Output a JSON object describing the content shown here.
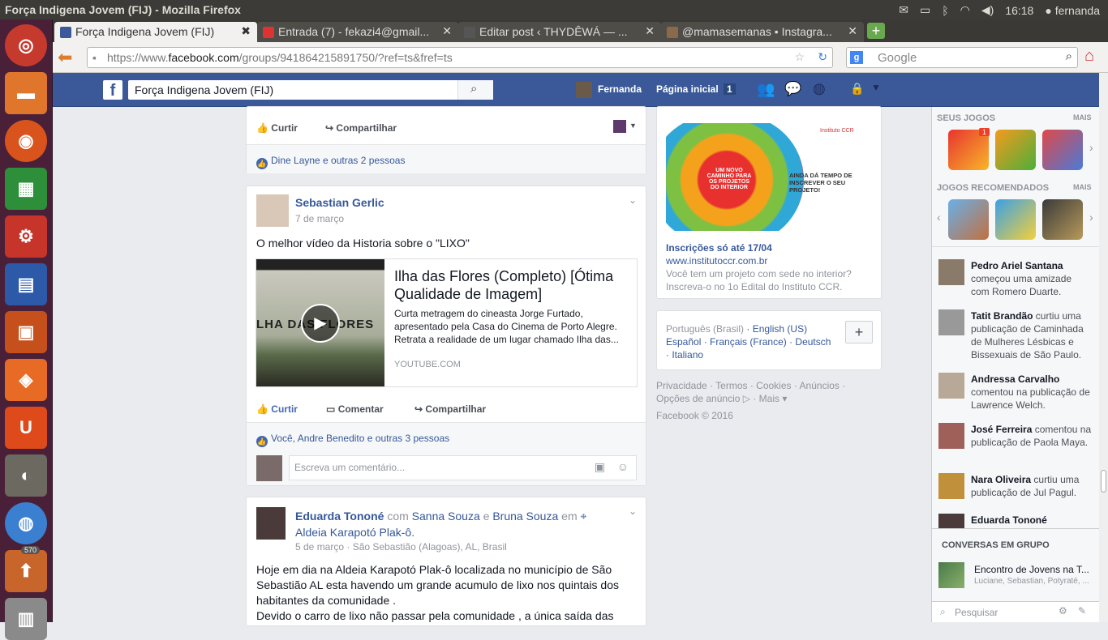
{
  "os": {
    "window_title": "Força Indigena Jovem (FIJ) - Mozilla Firefox",
    "clock": "16:18",
    "user": "fernanda",
    "launcher_badge": "570"
  },
  "browser": {
    "tabs": [
      {
        "label": "Força Indigena Jovem (FIJ)"
      },
      {
        "label": "Entrada (7) - fekazi4@gmail..."
      },
      {
        "label": "Editar post ‹ THYDÊWÁ — ..."
      },
      {
        "label": "@mamasemanas • Instagra..."
      }
    ],
    "url_prefix": "https://www.",
    "url_domain": "facebook.com",
    "url_rest": "/groups/941864215891750/?ref=ts&fref=ts",
    "search_placeholder": "Google"
  },
  "fb_header": {
    "search_value": "Força Indigena Jovem (FIJ)",
    "user_name": "Fernanda",
    "home_label": "Página inicial",
    "home_count": "1"
  },
  "feed": {
    "top_post": {
      "like": "Curtir",
      "share": "Compartilhar",
      "likes_text": "Dine Layne e outras 2 pessoas"
    },
    "post2": {
      "author": "Sebastian Gerlic",
      "date": "7 de março",
      "text": "O melhor vídeo da Historia sobre o \"LIXO\"",
      "video_thumb_text": "LHA DAS FLORES",
      "link_title": "Ilha das Flores (Completo) [Ótima Qualidade de Imagem]",
      "link_desc": "Curta metragem do cineasta Jorge Furtado, apresentado pela Casa do Cinema de Porto Alegre. Retrata a realidade de um lugar chamado Ilha das...",
      "link_source": "YOUTUBE.COM",
      "like": "Curtir",
      "comment": "Comentar",
      "share": "Compartilhar",
      "likes_text": "Você, Andre Benedito e outras 3 pessoas",
      "comment_placeholder": "Escreva um comentário..."
    },
    "post3": {
      "author": "Eduarda Tononé",
      "with_word": "com",
      "tag1": "Sanna Souza",
      "and_word": "e",
      "tag2": "Bruna Souza",
      "at_word": "em",
      "place": "Aldeia Karapotó Plak-ô.",
      "meta": "5 de março · São Sebastião (Alagoas), AL, Brasil",
      "text1": "Hoje em dia na Aldeia Karapotó Plak-ô localizada no município de São Sebastião AL esta havendo um grande acumulo de lixo nos quintais dos habitantes da comunidade .",
      "text2": "Devido o carro de lixo não passar pela comunidade , a única saída das"
    }
  },
  "ad": {
    "banner_text1": "UM NOVO CAMINHO PARA OS PROJETOS DO INTERIOR",
    "banner_text2": "AINDA DÁ TEMPO DE INSCREVER O SEU PROJETO!",
    "brand": "Instituto CCR",
    "title": "Inscrições só até 17/04",
    "url": "www.institutoccr.com.br",
    "desc": "Você tem um projeto com sede no interior? Inscreva-o no 1o Edital do Instituto CCR."
  },
  "languages": {
    "current": "Português (Brasil)",
    "items": [
      "English (US)",
      "Español",
      "Français (France)",
      "Deutsch",
      "Italiano"
    ],
    "add": "+"
  },
  "footer": {
    "links": [
      "Privacidade",
      "Termos",
      "Cookies",
      "Anúncios",
      "Opções de anúncio",
      "Mais"
    ],
    "copyright": "Facebook © 2016"
  },
  "sidebar": {
    "your_games": "SEUS JOGOS",
    "more1": "MAIS",
    "recommended": "JOGOS RECOMENDADOS",
    "more2": "MAIS",
    "game_badge": "1",
    "ticker": [
      {
        "name": "Pedro Ariel Santana",
        "text": "começou uma amizade com Romero Duarte."
      },
      {
        "name": "Tatit Brandão",
        "text": "curtiu uma publicação de Caminhada de Mulheres Lésbicas e Bissexuais de São Paulo."
      },
      {
        "name": "Andressa Carvalho",
        "text": "comentou na publicação de Lawrence Welch."
      },
      {
        "name": "José Ferreira",
        "text": "comentou na publicação de Paola Maya."
      },
      {
        "name": "Nara Oliveira",
        "text": "curtiu uma publicação de Jul Pagul."
      },
      {
        "name": "Eduarda Tononé",
        "text": ""
      }
    ],
    "group_chats": "CONVERSAS EM GRUPO",
    "chat_title": "Encontro de Jovens na T...",
    "chat_members": "Luciane, Sebastian, Potyraté, ...",
    "search_placeholder": "Pesquisar"
  }
}
